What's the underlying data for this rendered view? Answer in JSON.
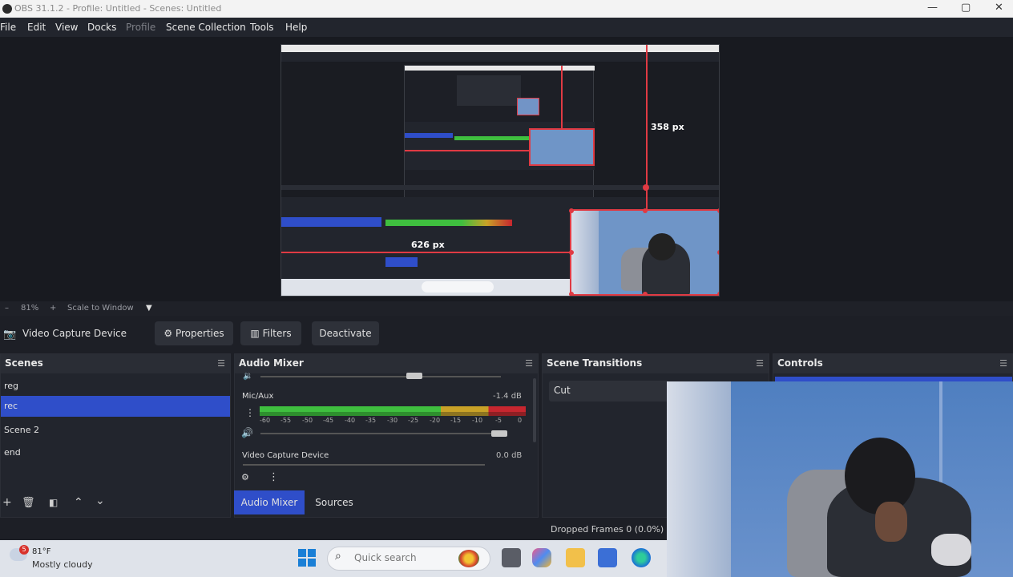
{
  "window": {
    "title": "OBS 31.1.2 - Profile: Untitled - Scenes: Untitled",
    "minimize": "—",
    "maximize": "▢",
    "close": "✕"
  },
  "menu": {
    "items": [
      "File",
      "Edit",
      "View",
      "Docks",
      "Profile",
      "Scene Collection",
      "Tools",
      "Help"
    ]
  },
  "preview": {
    "measure_vertical": "358 px",
    "measure_horizontal": "626 px"
  },
  "zoom": {
    "level": "81%",
    "mode": "Scale to Window"
  },
  "source_toolbar": {
    "source_name": "Video Capture Device",
    "properties_label": "Properties",
    "filters_label": "Filters",
    "deactivate_label": "Deactivate"
  },
  "scenes": {
    "header": "Scenes",
    "items": [
      "reg",
      "rec",
      "Scene 2",
      "end"
    ],
    "selected_index": 1
  },
  "audio_mixer": {
    "header": "Audio Mixer",
    "channels": [
      {
        "name": "Mic/Aux",
        "db": "-1.4 dB"
      },
      {
        "name": "Video Capture Device",
        "db": "0.0 dB"
      }
    ],
    "scale": [
      "-60",
      "-55",
      "-50",
      "-45",
      "-40",
      "-35",
      "-30",
      "-25",
      "-20",
      "-15",
      "-10",
      "-5",
      "0"
    ]
  },
  "scene_transitions": {
    "header": "Scene Transitions",
    "selected": "Cut"
  },
  "controls": {
    "header": "Controls"
  },
  "bottom_tabs": {
    "audio_mixer": "Audio Mixer",
    "sources": "Sources"
  },
  "status": {
    "dropped_frames": "Dropped Frames 0 (0.0%)"
  },
  "taskbar": {
    "weather_badge": "5",
    "weather_temp": "81°F",
    "weather_condition": "Mostly cloudy",
    "search_placeholder": "Quick search"
  },
  "colors": {
    "selection_blue": "#2f4ec9",
    "measure_red": "#e03a43",
    "meter_green": "#3fbf3f",
    "meter_yellow": "#c9a227",
    "meter_red": "#c7262f"
  }
}
